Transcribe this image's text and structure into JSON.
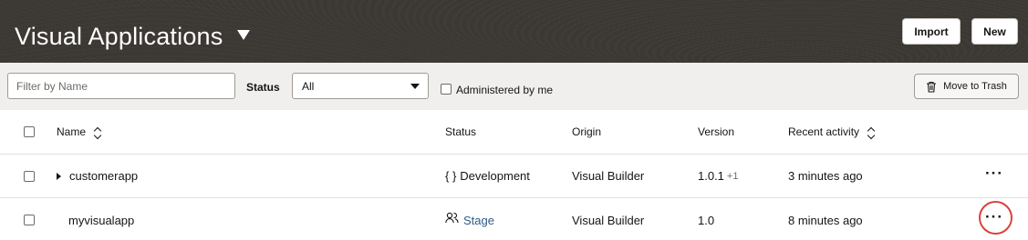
{
  "header": {
    "title": "Visual Applications",
    "import_label": "Import",
    "new_label": "New"
  },
  "filters": {
    "name_placeholder": "Filter by Name",
    "name_value": "",
    "status_label": "Status",
    "status_value": "All",
    "admin_label": "Administered by me",
    "admin_checked": false,
    "trash_label": "Move to Trash"
  },
  "table": {
    "columns": {
      "name": "Name",
      "status": "Status",
      "origin": "Origin",
      "version": "Version",
      "recent": "Recent activity"
    },
    "rows": [
      {
        "name": "customerapp",
        "expandable": true,
        "status_icon": "braces-icon",
        "status_symbol": "{ }",
        "status": "Development",
        "origin": "Visual Builder",
        "version": "1.0.1",
        "version_extra": "+1",
        "recent": "3 minutes ago",
        "more": "···"
      },
      {
        "name": "myvisualapp",
        "expandable": false,
        "status_icon": "users-icon",
        "status": "Stage",
        "origin": "Visual Builder",
        "version": "1.0",
        "recent": "8 minutes ago",
        "more": "···",
        "more_highlighted": true
      }
    ]
  },
  "colors": {
    "header_bg": "#3a3632",
    "stage_link": "#2c5c88",
    "highlight_ring": "#d9423c"
  }
}
